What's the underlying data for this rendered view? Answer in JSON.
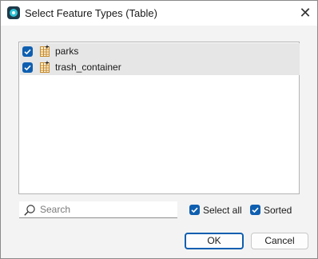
{
  "window": {
    "title": "Select Feature Types (Table)",
    "close_glyph": "✕",
    "app_icon": "app-logo-icon"
  },
  "list": {
    "items": [
      {
        "label": "parks",
        "checked": true,
        "icon": "table-icon"
      },
      {
        "label": "trash_container",
        "checked": true,
        "icon": "table-icon"
      }
    ]
  },
  "search": {
    "placeholder": "Search",
    "value": ""
  },
  "options": {
    "select_all_label": "Select all",
    "select_all_checked": true,
    "sorted_label": "Sorted",
    "sorted_checked": true
  },
  "buttons": {
    "ok_label": "OK",
    "cancel_label": "Cancel"
  },
  "colors": {
    "accent": "#0f5fb0",
    "row_selected": "#e6e6e6",
    "table_icon": "#c58a2a"
  }
}
